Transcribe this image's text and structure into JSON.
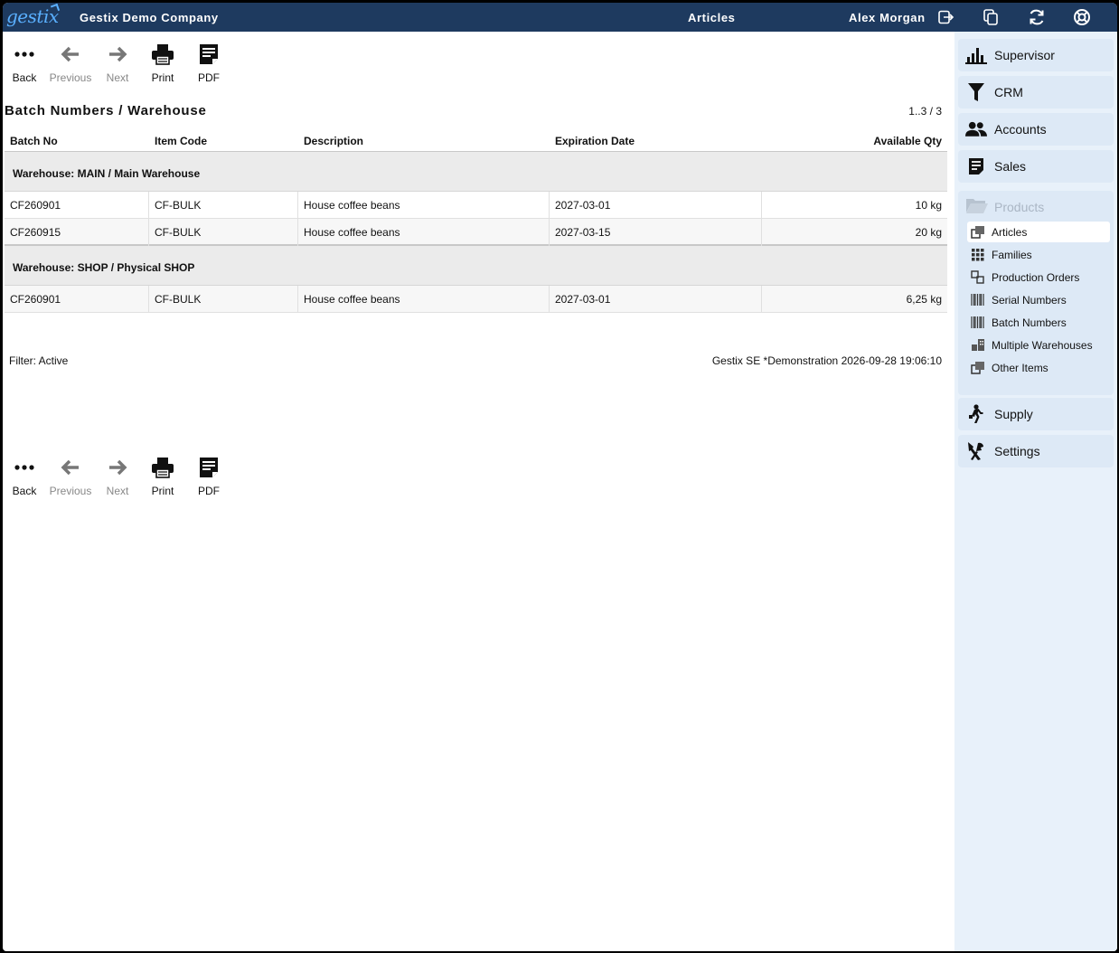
{
  "topbar": {
    "logo": "gestix",
    "company": "Gestix Demo Company",
    "section": "Articles",
    "user": "Alex Morgan",
    "icons": [
      "logout-icon",
      "copy-window-icon",
      "refresh-icon",
      "help-lifebuoy-icon"
    ]
  },
  "toolbar": {
    "back": "Back",
    "previous": "Previous",
    "next": "Next",
    "print": "Print",
    "pdf": "PDF"
  },
  "report": {
    "title": "Batch Numbers / Warehouse",
    "pager": "1..3 / 3",
    "columns": {
      "batch_no": "Batch No",
      "item_code": "Item Code",
      "description": "Description",
      "expiration_date": "Expiration Date",
      "available_qty": "Available Qty"
    },
    "groups": [
      {
        "label": "Warehouse: MAIN / Main Warehouse",
        "rows": [
          {
            "batch_no": "CF260901",
            "item_code": "CF-BULK",
            "description": "House coffee beans",
            "expiration_date": "2027-03-01",
            "available_qty": "10 kg"
          },
          {
            "batch_no": "CF260915",
            "item_code": "CF-BULK",
            "description": "House coffee beans",
            "expiration_date": "2027-03-15",
            "available_qty": "20 kg"
          }
        ]
      },
      {
        "label": "Warehouse: SHOP / Physical SHOP",
        "rows": [
          {
            "batch_no": "CF260901",
            "item_code": "CF-BULK",
            "description": "House coffee beans",
            "expiration_date": "2027-03-01",
            "available_qty": "6,25 kg"
          }
        ]
      }
    ],
    "filter": "Filter: Active",
    "footer_info": "Gestix SE *Demonstration 2026-09-28 19:06:10"
  },
  "sidebar": {
    "items_top": [
      {
        "label": "Supervisor",
        "icon": "bar-chart-icon"
      },
      {
        "label": "CRM",
        "icon": "funnel-icon"
      },
      {
        "label": "Accounts",
        "icon": "users-icon"
      },
      {
        "label": "Sales",
        "icon": "document-icon"
      }
    ],
    "products": {
      "label": "Products",
      "icon": "folder-open-icon",
      "items": [
        {
          "label": "Articles",
          "icon": "boxes-icon"
        },
        {
          "label": "Families",
          "icon": "grid-icon"
        },
        {
          "label": "Production Orders",
          "icon": "production-icon"
        },
        {
          "label": "Serial Numbers",
          "icon": "barcode-icon"
        },
        {
          "label": "Batch Numbers",
          "icon": "barcode-icon"
        },
        {
          "label": "Multiple Warehouses",
          "icon": "warehouse-icon"
        },
        {
          "label": "Other Items",
          "icon": "boxes-icon"
        }
      ]
    },
    "items_bottom": [
      {
        "label": "Supply",
        "icon": "delivery-person-icon"
      },
      {
        "label": "Settings",
        "icon": "tools-icon"
      }
    ]
  }
}
